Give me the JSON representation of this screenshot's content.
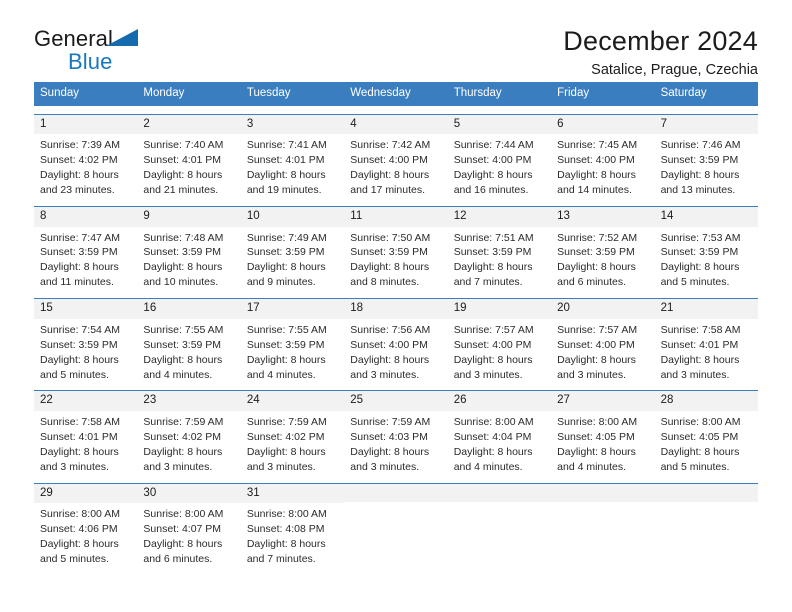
{
  "logo": {
    "word_one": "General",
    "word_two": "Blue",
    "triangle": "blue-triangle-mark"
  },
  "header": {
    "title": "December 2024",
    "subtitle": "Satalice, Prague, Czechia"
  },
  "colors": {
    "header_blue": "#3b7ec0",
    "logo_blue": "#1878be",
    "daynum_band": "#f2f2f2",
    "text": "#1c1c1c"
  },
  "weekdays": [
    "Sunday",
    "Monday",
    "Tuesday",
    "Wednesday",
    "Thursday",
    "Friday",
    "Saturday"
  ],
  "labels": {
    "sunrise_prefix": "Sunrise:",
    "sunset_prefix": "Sunset:",
    "daylight_prefix": "Daylight:"
  },
  "weeks": [
    [
      {
        "day": "1",
        "sunrise": "Sunrise: 7:39 AM",
        "sunset": "Sunset: 4:02 PM",
        "daylight_line1": "Daylight: 8 hours",
        "daylight_line2": "and 23 minutes."
      },
      {
        "day": "2",
        "sunrise": "Sunrise: 7:40 AM",
        "sunset": "Sunset: 4:01 PM",
        "daylight_line1": "Daylight: 8 hours",
        "daylight_line2": "and 21 minutes."
      },
      {
        "day": "3",
        "sunrise": "Sunrise: 7:41 AM",
        "sunset": "Sunset: 4:01 PM",
        "daylight_line1": "Daylight: 8 hours",
        "daylight_line2": "and 19 minutes."
      },
      {
        "day": "4",
        "sunrise": "Sunrise: 7:42 AM",
        "sunset": "Sunset: 4:00 PM",
        "daylight_line1": "Daylight: 8 hours",
        "daylight_line2": "and 17 minutes."
      },
      {
        "day": "5",
        "sunrise": "Sunrise: 7:44 AM",
        "sunset": "Sunset: 4:00 PM",
        "daylight_line1": "Daylight: 8 hours",
        "daylight_line2": "and 16 minutes."
      },
      {
        "day": "6",
        "sunrise": "Sunrise: 7:45 AM",
        "sunset": "Sunset: 4:00 PM",
        "daylight_line1": "Daylight: 8 hours",
        "daylight_line2": "and 14 minutes."
      },
      {
        "day": "7",
        "sunrise": "Sunrise: 7:46 AM",
        "sunset": "Sunset: 3:59 PM",
        "daylight_line1": "Daylight: 8 hours",
        "daylight_line2": "and 13 minutes."
      }
    ],
    [
      {
        "day": "8",
        "sunrise": "Sunrise: 7:47 AM",
        "sunset": "Sunset: 3:59 PM",
        "daylight_line1": "Daylight: 8 hours",
        "daylight_line2": "and 11 minutes."
      },
      {
        "day": "9",
        "sunrise": "Sunrise: 7:48 AM",
        "sunset": "Sunset: 3:59 PM",
        "daylight_line1": "Daylight: 8 hours",
        "daylight_line2": "and 10 minutes."
      },
      {
        "day": "10",
        "sunrise": "Sunrise: 7:49 AM",
        "sunset": "Sunset: 3:59 PM",
        "daylight_line1": "Daylight: 8 hours",
        "daylight_line2": "and 9 minutes."
      },
      {
        "day": "11",
        "sunrise": "Sunrise: 7:50 AM",
        "sunset": "Sunset: 3:59 PM",
        "daylight_line1": "Daylight: 8 hours",
        "daylight_line2": "and 8 minutes."
      },
      {
        "day": "12",
        "sunrise": "Sunrise: 7:51 AM",
        "sunset": "Sunset: 3:59 PM",
        "daylight_line1": "Daylight: 8 hours",
        "daylight_line2": "and 7 minutes."
      },
      {
        "day": "13",
        "sunrise": "Sunrise: 7:52 AM",
        "sunset": "Sunset: 3:59 PM",
        "daylight_line1": "Daylight: 8 hours",
        "daylight_line2": "and 6 minutes."
      },
      {
        "day": "14",
        "sunrise": "Sunrise: 7:53 AM",
        "sunset": "Sunset: 3:59 PM",
        "daylight_line1": "Daylight: 8 hours",
        "daylight_line2": "and 5 minutes."
      }
    ],
    [
      {
        "day": "15",
        "sunrise": "Sunrise: 7:54 AM",
        "sunset": "Sunset: 3:59 PM",
        "daylight_line1": "Daylight: 8 hours",
        "daylight_line2": "and 5 minutes."
      },
      {
        "day": "16",
        "sunrise": "Sunrise: 7:55 AM",
        "sunset": "Sunset: 3:59 PM",
        "daylight_line1": "Daylight: 8 hours",
        "daylight_line2": "and 4 minutes."
      },
      {
        "day": "17",
        "sunrise": "Sunrise: 7:55 AM",
        "sunset": "Sunset: 3:59 PM",
        "daylight_line1": "Daylight: 8 hours",
        "daylight_line2": "and 4 minutes."
      },
      {
        "day": "18",
        "sunrise": "Sunrise: 7:56 AM",
        "sunset": "Sunset: 4:00 PM",
        "daylight_line1": "Daylight: 8 hours",
        "daylight_line2": "and 3 minutes."
      },
      {
        "day": "19",
        "sunrise": "Sunrise: 7:57 AM",
        "sunset": "Sunset: 4:00 PM",
        "daylight_line1": "Daylight: 8 hours",
        "daylight_line2": "and 3 minutes."
      },
      {
        "day": "20",
        "sunrise": "Sunrise: 7:57 AM",
        "sunset": "Sunset: 4:00 PM",
        "daylight_line1": "Daylight: 8 hours",
        "daylight_line2": "and 3 minutes."
      },
      {
        "day": "21",
        "sunrise": "Sunrise: 7:58 AM",
        "sunset": "Sunset: 4:01 PM",
        "daylight_line1": "Daylight: 8 hours",
        "daylight_line2": "and 3 minutes."
      }
    ],
    [
      {
        "day": "22",
        "sunrise": "Sunrise: 7:58 AM",
        "sunset": "Sunset: 4:01 PM",
        "daylight_line1": "Daylight: 8 hours",
        "daylight_line2": "and 3 minutes."
      },
      {
        "day": "23",
        "sunrise": "Sunrise: 7:59 AM",
        "sunset": "Sunset: 4:02 PM",
        "daylight_line1": "Daylight: 8 hours",
        "daylight_line2": "and 3 minutes."
      },
      {
        "day": "24",
        "sunrise": "Sunrise: 7:59 AM",
        "sunset": "Sunset: 4:02 PM",
        "daylight_line1": "Daylight: 8 hours",
        "daylight_line2": "and 3 minutes."
      },
      {
        "day": "25",
        "sunrise": "Sunrise: 7:59 AM",
        "sunset": "Sunset: 4:03 PM",
        "daylight_line1": "Daylight: 8 hours",
        "daylight_line2": "and 3 minutes."
      },
      {
        "day": "26",
        "sunrise": "Sunrise: 8:00 AM",
        "sunset": "Sunset: 4:04 PM",
        "daylight_line1": "Daylight: 8 hours",
        "daylight_line2": "and 4 minutes."
      },
      {
        "day": "27",
        "sunrise": "Sunrise: 8:00 AM",
        "sunset": "Sunset: 4:05 PM",
        "daylight_line1": "Daylight: 8 hours",
        "daylight_line2": "and 4 minutes."
      },
      {
        "day": "28",
        "sunrise": "Sunrise: 8:00 AM",
        "sunset": "Sunset: 4:05 PM",
        "daylight_line1": "Daylight: 8 hours",
        "daylight_line2": "and 5 minutes."
      }
    ],
    [
      {
        "day": "29",
        "sunrise": "Sunrise: 8:00 AM",
        "sunset": "Sunset: 4:06 PM",
        "daylight_line1": "Daylight: 8 hours",
        "daylight_line2": "and 5 minutes."
      },
      {
        "day": "30",
        "sunrise": "Sunrise: 8:00 AM",
        "sunset": "Sunset: 4:07 PM",
        "daylight_line1": "Daylight: 8 hours",
        "daylight_line2": "and 6 minutes."
      },
      {
        "day": "31",
        "sunrise": "Sunrise: 8:00 AM",
        "sunset": "Sunset: 4:08 PM",
        "daylight_line1": "Daylight: 8 hours",
        "daylight_line2": "and 7 minutes."
      },
      {
        "day": "",
        "sunrise": "",
        "sunset": "",
        "daylight_line1": "",
        "daylight_line2": ""
      },
      {
        "day": "",
        "sunrise": "",
        "sunset": "",
        "daylight_line1": "",
        "daylight_line2": ""
      },
      {
        "day": "",
        "sunrise": "",
        "sunset": "",
        "daylight_line1": "",
        "daylight_line2": ""
      },
      {
        "day": "",
        "sunrise": "",
        "sunset": "",
        "daylight_line1": "",
        "daylight_line2": ""
      }
    ]
  ]
}
